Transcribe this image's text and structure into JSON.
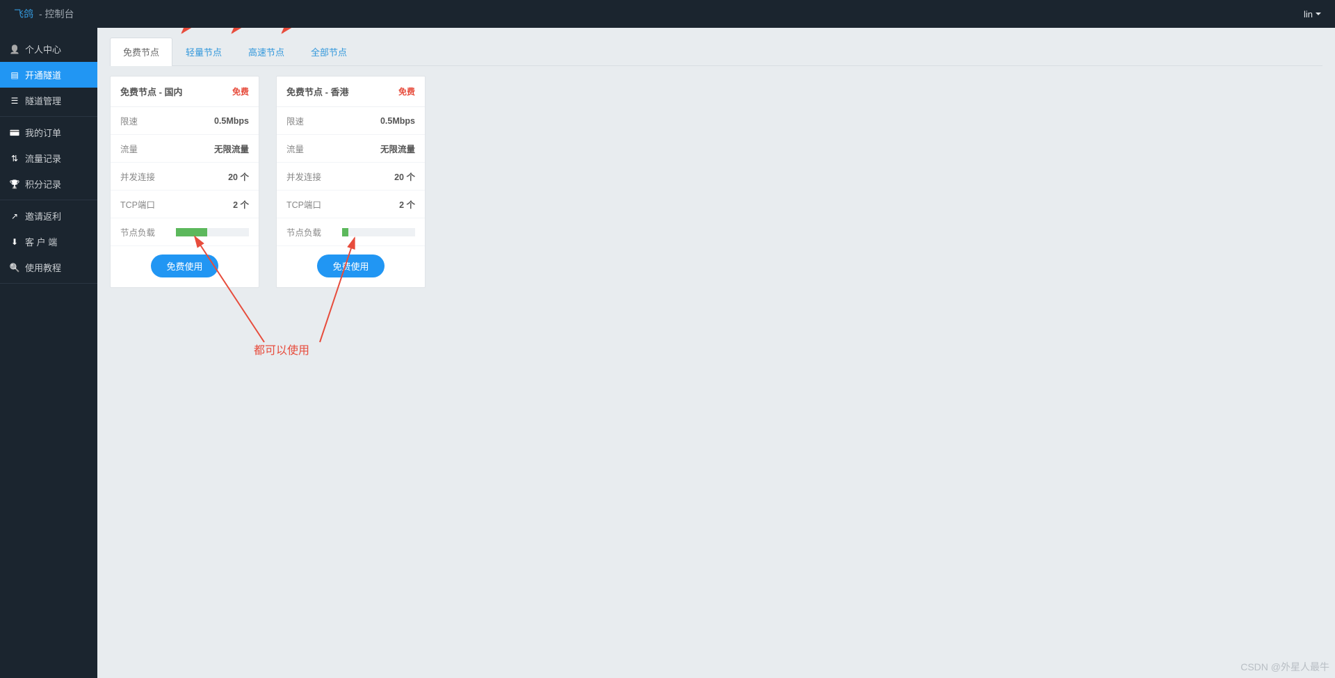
{
  "header": {
    "brand": "飞鸽",
    "brand_sub": "- 控制台",
    "user": "lin"
  },
  "sidebar": {
    "groups": [
      {
        "items": [
          {
            "icon": "user",
            "label": "个人中心",
            "active": false
          },
          {
            "icon": "stack",
            "label": "开通隧道",
            "active": true
          },
          {
            "icon": "list",
            "label": "隧道管理",
            "active": false
          }
        ]
      },
      {
        "items": [
          {
            "icon": "card",
            "label": "我的订单",
            "active": false
          },
          {
            "icon": "transfer",
            "label": "流量记录",
            "active": false
          },
          {
            "icon": "trophy",
            "label": "积分记录",
            "active": false
          }
        ]
      },
      {
        "items": [
          {
            "icon": "share",
            "label": "邀请返利",
            "active": false
          },
          {
            "icon": "download",
            "label": "客 户 端",
            "active": false
          },
          {
            "icon": "search",
            "label": "使用教程",
            "active": false
          }
        ]
      }
    ]
  },
  "tabs": [
    {
      "label": "免费节点",
      "active": true
    },
    {
      "label": "轻量节点",
      "active": false
    },
    {
      "label": "高速节点",
      "active": false
    },
    {
      "label": "全部节点",
      "active": false
    }
  ],
  "cards": [
    {
      "title": "免费节点 - 国内",
      "badge": "免费",
      "rows": [
        {
          "label": "限速",
          "value": "0.5Mbps"
        },
        {
          "label": "流量",
          "value": "无限流量"
        },
        {
          "label": "并发连接",
          "value": "20 个"
        },
        {
          "label": "TCP端口",
          "value": "2 个"
        }
      ],
      "load_label": "节点负载",
      "load_pct": 43,
      "button": "免费使用"
    },
    {
      "title": "免费节点 - 香港",
      "badge": "免费",
      "rows": [
        {
          "label": "限速",
          "value": "0.5Mbps"
        },
        {
          "label": "流量",
          "value": "无限流量"
        },
        {
          "label": "并发连接",
          "value": "20 个"
        },
        {
          "label": "TCP端口",
          "value": "2 个"
        }
      ],
      "load_label": "节点负载",
      "load_pct": 9,
      "button": "免费使用"
    }
  ],
  "annotation": {
    "text": "都可以使用"
  },
  "watermark": "CSDN @外星人最牛"
}
